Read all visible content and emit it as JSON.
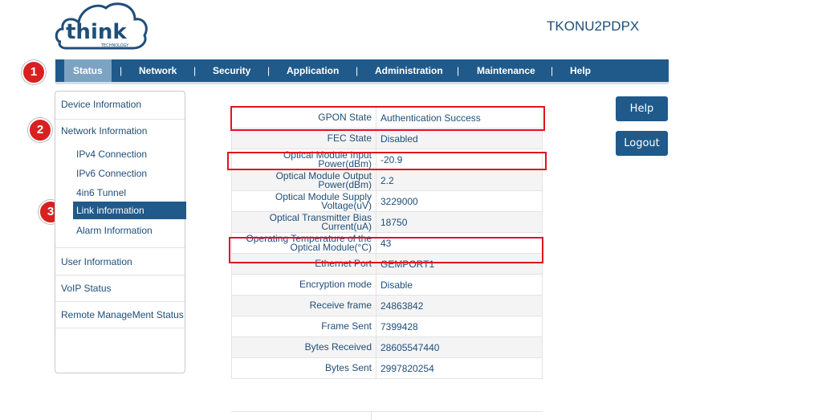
{
  "brand": {
    "logo_text": "think",
    "logo_sub": "TECHNOLOGY"
  },
  "device_model": "TKONU2PDPX",
  "nav": {
    "items": [
      "Status",
      "Network",
      "Security",
      "Application",
      "Administration",
      "Maintenance",
      "Help"
    ],
    "separator": "|",
    "active": "Status"
  },
  "badges": [
    "1",
    "2",
    "3"
  ],
  "sidebar": {
    "device_information": "Device Information",
    "network_information": "Network Information",
    "network_sub": [
      "IPv4 Connection",
      "IPv6 Connection",
      "4in6 Tunnel",
      "Link information",
      "Alarm Information"
    ],
    "user_information": "User Information",
    "voip_status": "VoIP Status",
    "remote_management_status": "Remote ManageMent Status"
  },
  "link_info": [
    {
      "label": "GPON State",
      "value": "Authentication Success"
    },
    {
      "label": "FEC State",
      "value": "Disabled"
    },
    {
      "label": "Optical Module Input Power(dBm)",
      "value": "-20.9"
    },
    {
      "label": "Optical Module Output Power(dBm)",
      "value": "2.2"
    },
    {
      "label": "Optical Module Supply Voltage(uV)",
      "value": "3229000"
    },
    {
      "label": "Optical Transmitter Bias Current(uA)",
      "value": "18750"
    },
    {
      "label": "Operating Temperature of the Optical Module(°C)",
      "value": "43"
    },
    {
      "label": "Ethernet Port",
      "value": "GEMPORT1"
    },
    {
      "label": "Encryption mode",
      "value": "Disable"
    },
    {
      "label": "Receive frame",
      "value": "24863842"
    },
    {
      "label": "Frame Sent",
      "value": "7399428"
    },
    {
      "label": "Bytes Received",
      "value": "28605547440"
    },
    {
      "label": "Bytes Sent",
      "value": "2997820254"
    }
  ],
  "buttons": {
    "help": "Help",
    "logout": "Logout"
  },
  "colors": {
    "primary": "#1f5a8b",
    "active_tab": "#7da3c3",
    "highlight": "#e0141e",
    "badge": "#d82020"
  }
}
